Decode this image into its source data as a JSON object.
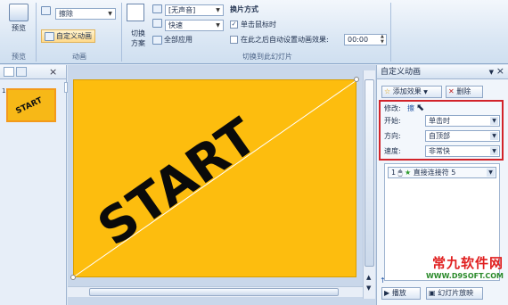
{
  "ribbon": {
    "preview_group": {
      "preview_label": "预览",
      "group_label": "预览"
    },
    "animation_group": {
      "animate_select_value": "擦除",
      "custom_animation_label": "自定义动画",
      "group_label": "动画"
    },
    "transition_group": {
      "transition_scheme_label_line1": "切换",
      "transition_scheme_label_line2": "方案",
      "sound_value": "[无声音]",
      "speed_value": "快速",
      "apply_all_label": "全部应用",
      "advance_title": "换片方式",
      "on_click_label": "单击鼠标时",
      "on_click_checked": true,
      "auto_after_label": "在此之后自动设置动画效果:",
      "auto_after_checked": false,
      "auto_after_time": "00:00",
      "group_label": "切换到此幻灯片"
    }
  },
  "slides_pane": {
    "slide_number": "1",
    "thumbnail_text": "START"
  },
  "slide": {
    "text": "START",
    "background_color": "#fdbd0e"
  },
  "anim_pane": {
    "title": "自定义动画",
    "add_effect_label": "添加效果",
    "remove_label": "删除",
    "modify_label": "修改:",
    "modify_value": "擦",
    "start_label": "开始:",
    "start_value": "单击时",
    "direction_label": "方向:",
    "direction_value": "自顶部",
    "speed_label": "速度:",
    "speed_value": "非常快",
    "list_item_index": "1",
    "list_item_text": "直接连接符 5",
    "play_label": "播放",
    "slideshow_label": "幻灯片放映"
  },
  "watermark": {
    "main": "常九软件网",
    "url": "WWW.D9SOFT.COM"
  },
  "colors": {
    "highlight_border": "#d2232a",
    "slide_fill": "#fdbd0e"
  }
}
